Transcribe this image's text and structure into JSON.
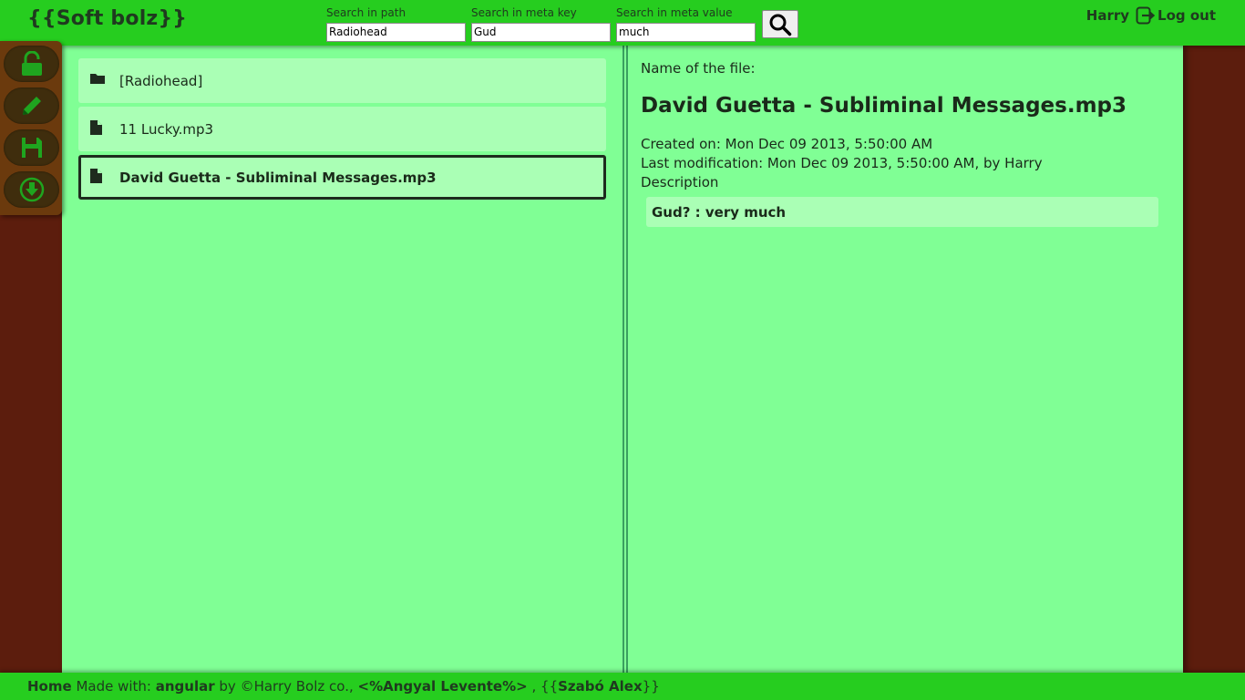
{
  "header": {
    "brand": "{{Soft bolz}}",
    "search_path_label": "Search in path",
    "search_path_value": "Radiohead",
    "search_key_label": "Search in meta key",
    "search_key_value": "Gud",
    "search_value_label": "Search in meta value",
    "search_value_value": "much",
    "user_name": "Harry",
    "logout_label": "Log out"
  },
  "toolbar": {
    "icons": [
      "unlock-icon",
      "pencil-icon",
      "save-icon",
      "download-icon"
    ]
  },
  "files": [
    {
      "type": "folder",
      "name": "[Radiohead]"
    },
    {
      "type": "file",
      "name": "11 Lucky.mp3"
    },
    {
      "type": "file",
      "name": "David Guetta - Subliminal Messages.mp3",
      "selected": true
    }
  ],
  "detail": {
    "name_label": "Name of the file:",
    "file_name": "David Guetta - Subliminal Messages.mp3",
    "created": "Created on: Mon Dec 09 2013, 5:50:00 AM",
    "modified": "Last modification: Mon Dec 09 2013, 5:50:00 AM, by Harry",
    "description_label": "Description",
    "meta_entry": "Gud? : very much"
  },
  "footer": {
    "home": "Home",
    "made_with": " Made with: ",
    "framework": "angular",
    "by": " by ©Harry Bolz co., ",
    "author1": "<%Angyal Levente%>",
    "sep": " , {{",
    "author2": "Szabó Alex",
    "end": "}}"
  },
  "colors": {
    "header_bg": "#26cd1f",
    "content_bg": "#80ff95",
    "item_bg": "#aaffb5",
    "side_bg": "#5c1d0d",
    "toolbar_bg": "#6b3a0d",
    "icon_green": "#1fa51f"
  }
}
